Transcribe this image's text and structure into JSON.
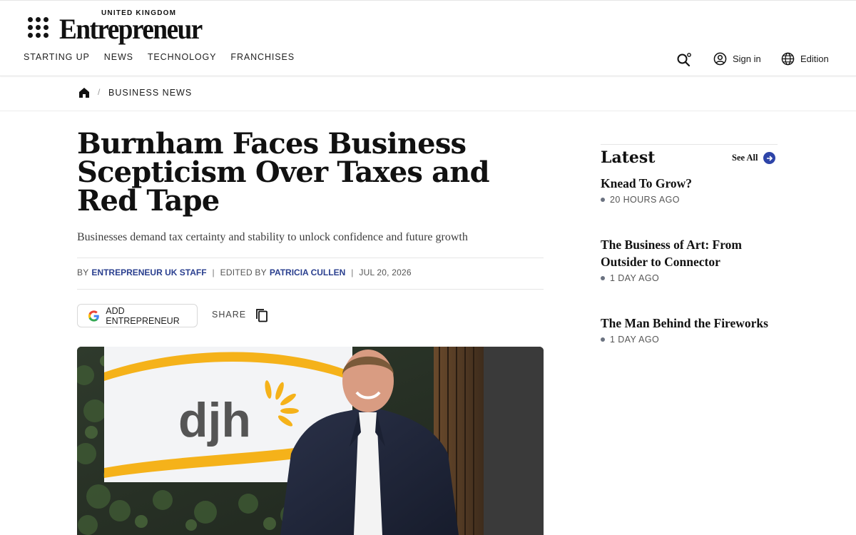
{
  "header": {
    "logo_edition": "UNITED KINGDOM",
    "logo_word": "Entrepreneur",
    "nav": [
      {
        "label": "STARTING UP"
      },
      {
        "label": "NEWS"
      },
      {
        "label": "TECHNOLOGY"
      },
      {
        "label": "FRANCHISES"
      }
    ],
    "sign_in": "Sign in",
    "edition": "Edition"
  },
  "breadcrumb": {
    "current": "BUSINESS NEWS",
    "separator": "/"
  },
  "article": {
    "headline": "Burnham Faces Business Scepticism Over Taxes and Red Tape",
    "dek": "Businesses demand tax certainty and stability to unlock confidence and future growth",
    "by_label": "BY",
    "author": "ENTREPRENEUR UK STAFF",
    "edited_label": "EDITED BY",
    "editor": "PATRICIA CULLEN",
    "date": "JUL 20, 2026",
    "add_button": "ADD ENTREPRENEUR",
    "share_label": "SHARE",
    "image_sign_text": "djh"
  },
  "sidebar": {
    "title": "Latest",
    "see_all": "See All",
    "stories": [
      {
        "title": "Knead To Grow?",
        "time": "20 HOURS AGO"
      },
      {
        "title": "The Business of Art: From Outsider to Connector",
        "time": "1 DAY AGO"
      },
      {
        "title": "The Man Behind the Fireworks",
        "time": "1 DAY AGO"
      }
    ]
  },
  "colors": {
    "accent_blue": "#2d44a8",
    "author_blue": "#2a3f8f",
    "logo_orange": "#f5b21a"
  },
  "icons": [
    "menu-grid-icon",
    "search-icon",
    "user-circle-icon",
    "globe-icon",
    "home-icon",
    "google-icon",
    "copy-icon",
    "arrow-right-icon",
    "bullet-dot-icon"
  ]
}
